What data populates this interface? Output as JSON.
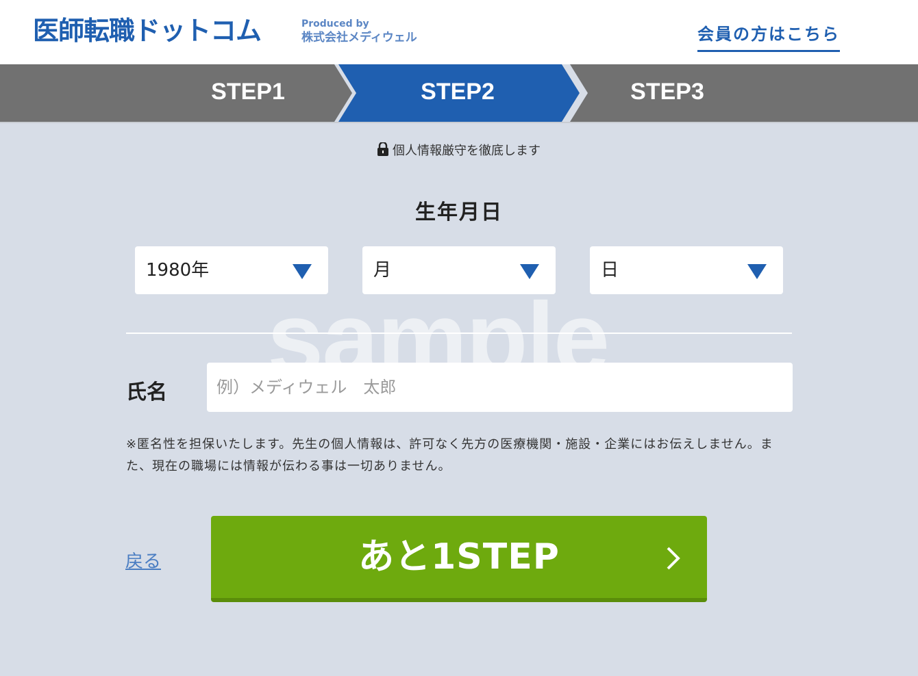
{
  "header": {
    "logo": "医師転職ドットコム",
    "produced_by": "Produced by",
    "company": "株式会社メディウェル",
    "member_link": "会員の方はこちら"
  },
  "steps": [
    {
      "label": "STEP1",
      "active": false
    },
    {
      "label": "STEP2",
      "active": true
    },
    {
      "label": "STEP3",
      "active": false
    }
  ],
  "privacy_note": "個人情報厳守を徹底します",
  "birthdate": {
    "title": "生年月日",
    "year": "1980年",
    "month": "月",
    "day": "日"
  },
  "watermark": "sample",
  "name": {
    "label": "氏名",
    "placeholder": "例）メディウェル　太郎",
    "value": ""
  },
  "anonymity_note": "※匿名性を担保いたします。先生の個人情報は、許可なく先方の医療機関・施設・企業にはお伝えしません。また、現在の職場には情報が伝わる事は一切ありません。",
  "actions": {
    "back": "戻る",
    "next": "あと1STEP"
  },
  "colors": {
    "brand_blue": "#1f5fb0",
    "step_active": "#1f5fb0",
    "step_inactive": "#717171",
    "next_green": "#6eaa0e",
    "page_bg": "#d7dde7"
  }
}
